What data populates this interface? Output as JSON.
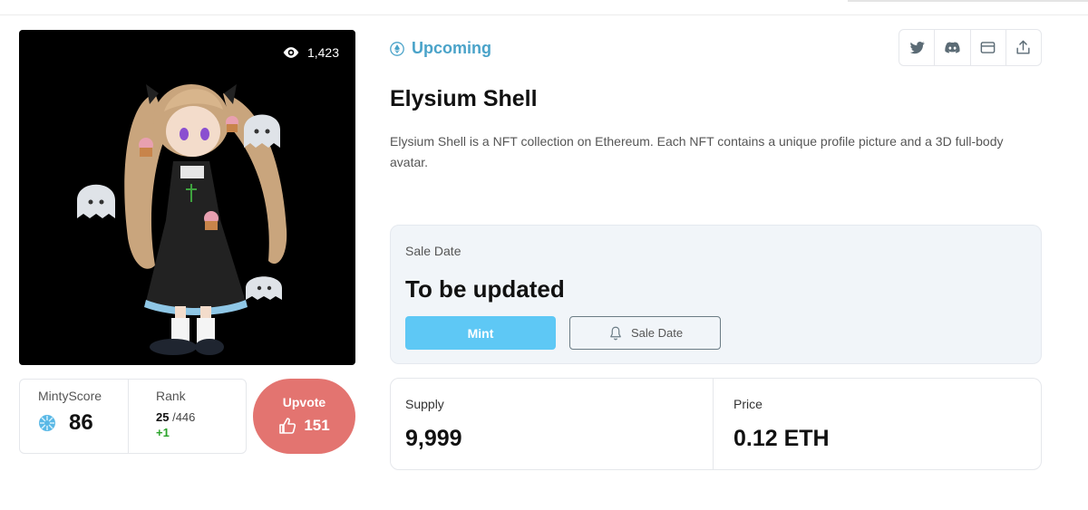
{
  "hero": {
    "views": "1,423",
    "image_alt": "Elysium Shell avatar"
  },
  "stats": {
    "score_label": "MintyScore",
    "score_value": "86",
    "rank_label": "Rank",
    "rank_value": "25",
    "rank_total": "/446",
    "rank_delta": "+1"
  },
  "upvote": {
    "label": "Upvote",
    "count": "151"
  },
  "project": {
    "status": "Upcoming",
    "title": "Elysium Shell",
    "description": "Elysium Shell is a NFT collection on Ethereum. Each NFT contains a unique profile picture and a 3D full-body avatar."
  },
  "socials": [
    "twitter-icon",
    "discord-icon",
    "website-icon",
    "share-icon"
  ],
  "sale": {
    "label": "Sale Date",
    "value": "To be updated",
    "mint_label": "Mint",
    "saledate_label": "Sale Date"
  },
  "info": {
    "supply_label": "Supply",
    "supply_value": "9,999",
    "price_label": "Price",
    "price_value": "0.12 ETH"
  },
  "colors": {
    "accent": "#4aa3c9",
    "mint": "#5ec8f5",
    "upvote": "#e37470",
    "delta": "#2aa32a"
  }
}
